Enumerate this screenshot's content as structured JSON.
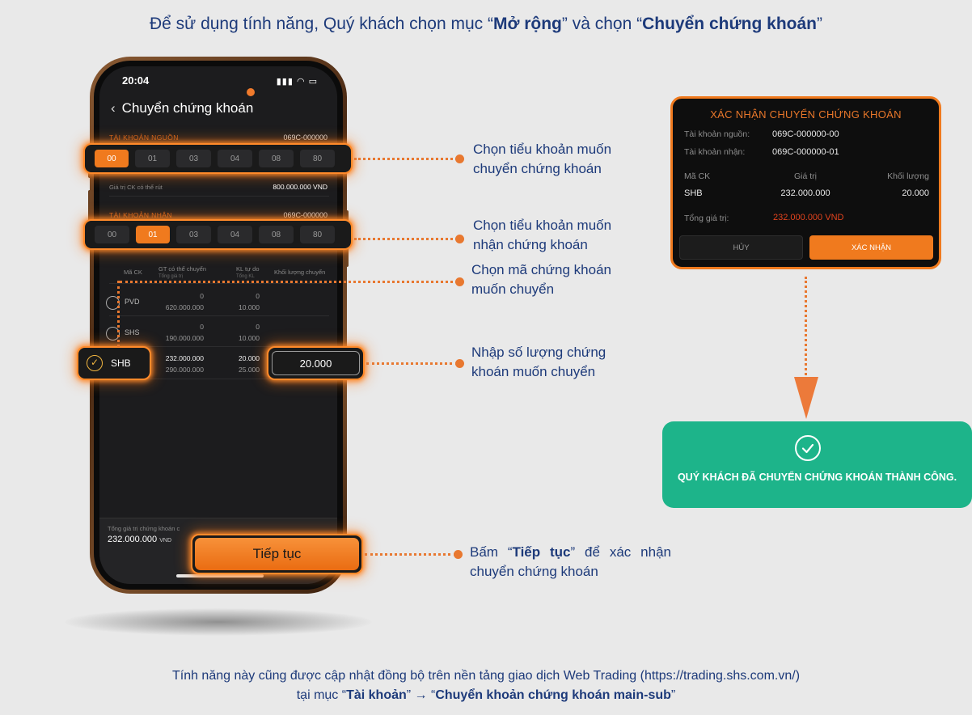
{
  "header": {
    "pre": "Để sử dụng tính năng, Quý khách chọn mục “",
    "bold1": "Mở rộng",
    "mid": "” và chọn “",
    "bold2": "Chuyển chứng khoán",
    "post": "”"
  },
  "phone": {
    "time": "20:04",
    "title": "Chuyển chứng khoán",
    "source": {
      "label": "TÀI KHOẢN NGUỒN",
      "account": "069C-000000",
      "subaccounts": [
        "00",
        "01",
        "03",
        "04",
        "08",
        "80"
      ],
      "selected": "00"
    },
    "withdrawable": {
      "label": "Giá trị CK có thể rút",
      "value": "800.000.000 VND"
    },
    "target": {
      "label": "TÀI KHOẢN NHẬN",
      "account": "069C-000000",
      "subaccounts": [
        "00",
        "01",
        "03",
        "04",
        "08",
        "80"
      ],
      "selected": "01"
    },
    "table": {
      "headers": {
        "code": "Mã CK",
        "value": "GT có thể chuyển",
        "value_sub": "Tổng giá trị",
        "qty": "KL tự do",
        "qty_sub": "Tổng KL",
        "transfer": "Khối lượng chuyển"
      },
      "rows": [
        {
          "code": "PVD",
          "value": "0",
          "total": "620.000.000",
          "qty": "0",
          "total_qty": "10.000"
        },
        {
          "code": "SHS",
          "value": "0",
          "total": "190.000.000",
          "qty": "0",
          "total_qty": "10.000"
        },
        {
          "code": "SHB",
          "value": "232.000.000",
          "total": "290.000.000",
          "qty": "20.000",
          "total_qty": "25.000"
        }
      ]
    },
    "transfer_input": "20.000",
    "total": {
      "label": "Tổng giá trị chứng khoán c",
      "value": "232.000.000",
      "unit": "VND"
    },
    "continue_button": "Tiếp tục"
  },
  "annotations": {
    "a1": {
      "l1": "Chọn tiểu khoản muốn",
      "l2": "chuyển chứng khoán"
    },
    "a2": {
      "l1": "Chọn tiểu khoản muốn",
      "l2": "nhận chứng khoán"
    },
    "a3": {
      "l1": "Chọn mã chứng khoán",
      "l2": "muốn chuyển"
    },
    "a4": {
      "l1": "Nhập số lượng chứng",
      "l2": "khoán muốn chuyển"
    },
    "a5": {
      "pre": "Bấm “",
      "bold": "Tiếp tục",
      "post": "” để xác nhận",
      "l2": "chuyển chứng khoán"
    }
  },
  "modal": {
    "title": "XÁC NHẬN CHUYỂN CHỨNG KHOÁN",
    "source_label": "Tài khoản nguồn:",
    "source_value": "069C-000000-00",
    "target_label": "Tài khoản nhận:",
    "target_value": "069C-000000-01",
    "col_code": "Mã CK",
    "col_value": "Giá trị",
    "col_qty": "Khối lượng",
    "code": "SHB",
    "value": "232.000.000",
    "qty": "20.000",
    "total_label": "Tổng giá trị:",
    "total_value": "232.000.000 VND",
    "cancel": "HỦY",
    "confirm": "XÁC NHẬN"
  },
  "success": {
    "text": "QUÝ KHÁCH ĐÃ CHUYỂN CHỨNG KHOÁN THÀNH CÔNG."
  },
  "footer": {
    "line1": "Tính năng này cũng được cập nhật đồng bộ trên nền tảng giao dịch Web Trading (https://trading.shs.com.vn/)",
    "l2_pre": "tại mục “",
    "l2_b1": "Tài khoản",
    "l2_mid": "” → “",
    "l2_b2": "Chuyển khoản chứng khoán main-sub",
    "l2_post": "”"
  },
  "colors": {
    "accent": "#f07a1e",
    "navy": "#1d3a7a",
    "success": "#1db48a",
    "error": "#e2431e"
  }
}
